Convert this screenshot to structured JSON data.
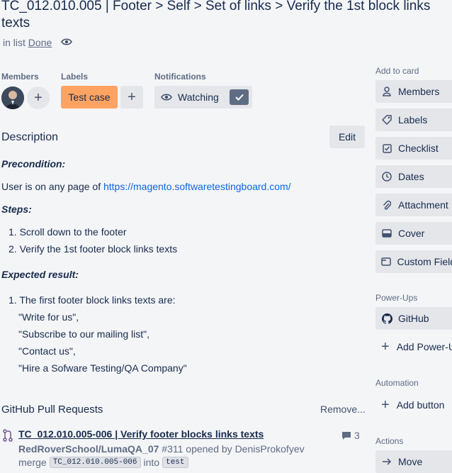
{
  "card": {
    "title": "TC_012.010.005 | Footer > Self > Set of links > Verify the 1st block links texts",
    "in_list_prefix": "in list",
    "list_name": "Done"
  },
  "members": {
    "label": "Members"
  },
  "labels": {
    "label": "Labels",
    "items": [
      "Test case"
    ],
    "label_color": "#fea362"
  },
  "notifications": {
    "label": "Notifications",
    "watch_label": "Watching"
  },
  "description": {
    "heading": "Description",
    "edit_label": "Edit",
    "precondition_title": "Precondition:",
    "precondition_text": "User is on any page of",
    "precondition_link": "https://magento.softwaretestingboard.com/",
    "steps_title": "Steps:",
    "steps": [
      "1. Scroll down to the footer",
      "2. Verify the 1st footer block links texts"
    ],
    "expected_title": "Expected result:",
    "expected_lines": [
      "1. The first footer block links texts are:",
      "\"Write for us\",",
      "\"Subscribe to our mailing list\",",
      "\"Contact us\",",
      "\"Hire a Sofware Testing/QA Company\""
    ]
  },
  "github": {
    "heading": "GitHub Pull Requests",
    "remove_label": "Remove...",
    "pr_title": "TC_012.010.005-006 | Verify footer blocks links texts",
    "comments": "3",
    "repo": "RedRoverSchool/LumaQA_07",
    "pr_number": "#311",
    "opened_by": "opened by DenisProkofyev",
    "merge_label": "merge",
    "branch_from": "TC_012.010.005-006",
    "into_label": "into",
    "branch_to": "test"
  },
  "sidebar": {
    "add_to_card_label": "Add to card",
    "add_to_card": [
      "Members",
      "Labels",
      "Checklist",
      "Dates",
      "Attachment",
      "Cover",
      "Custom Fields"
    ],
    "powerups_label": "Power-Ups",
    "powerups_github": "GitHub",
    "add_powerup": "Add Power-Ups",
    "automation_label": "Automation",
    "add_button": "Add button",
    "actions_label": "Actions",
    "move": "Move"
  }
}
